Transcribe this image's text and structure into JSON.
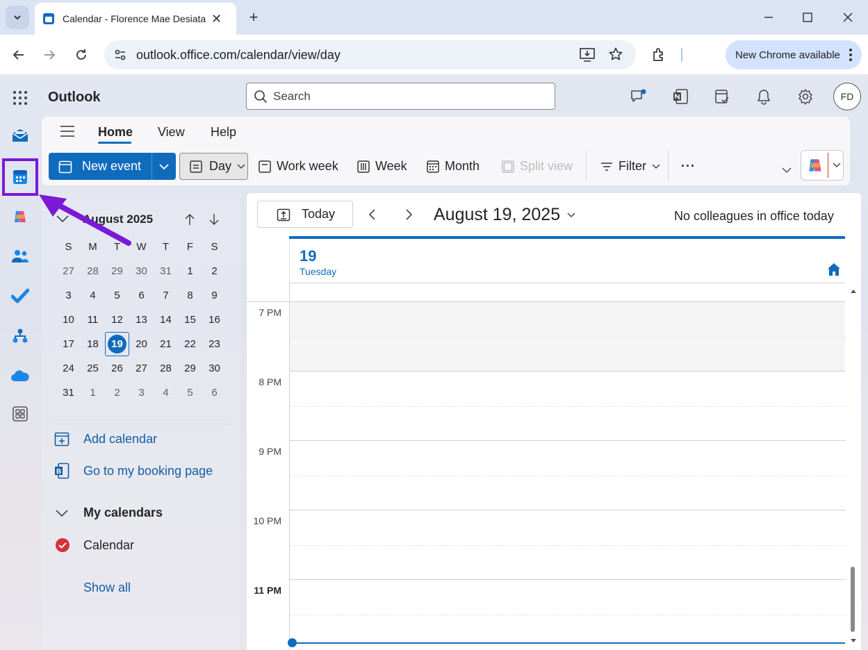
{
  "browser": {
    "tab_title": "Calendar - Florence Mae Desiata",
    "url": "outlook.office.com/calendar/view/day",
    "update_pill": "New Chrome available"
  },
  "app": {
    "name": "Outlook",
    "search_placeholder": "Search",
    "avatar_initials": "FD"
  },
  "ribbon": {
    "tabs": [
      "Home",
      "View",
      "Help"
    ],
    "new_event": "New event",
    "views": {
      "day": "Day",
      "work_week": "Work week",
      "week": "Week",
      "month": "Month",
      "split_view": "Split view"
    },
    "filter": "Filter",
    "more": "···"
  },
  "mini_calendar": {
    "month_label": "August 2025",
    "weekdays": [
      "S",
      "M",
      "T",
      "W",
      "T",
      "F",
      "S"
    ],
    "weeks": [
      [
        "27",
        "28",
        "29",
        "30",
        "31",
        "1",
        "2"
      ],
      [
        "3",
        "4",
        "5",
        "6",
        "7",
        "8",
        "9"
      ],
      [
        "10",
        "11",
        "12",
        "13",
        "14",
        "15",
        "16"
      ],
      [
        "17",
        "18",
        "19",
        "20",
        "21",
        "22",
        "23"
      ],
      [
        "24",
        "25",
        "26",
        "27",
        "28",
        "29",
        "30"
      ],
      [
        "31",
        "1",
        "2",
        "3",
        "4",
        "5",
        "6"
      ]
    ],
    "selected_day": "19"
  },
  "left_links": {
    "add_calendar": "Add calendar",
    "booking_page": "Go to my booking page",
    "my_calendars": "My calendars",
    "calendar": "Calendar",
    "show_all": "Show all"
  },
  "main": {
    "today_button": "Today",
    "date_title": "August 19, 2025",
    "colleagues": "No colleagues in office today",
    "day_number": "19",
    "day_name": "Tuesday",
    "time_labels": [
      "7 PM",
      "8 PM",
      "9 PM",
      "10 PM",
      "11 PM"
    ]
  },
  "colors": {
    "accent": "#0f6cbd",
    "annotation": "#7a19d6",
    "calendar_check": "#d13438"
  },
  "icons": {
    "rail": [
      "mail-icon",
      "calendar-icon",
      "copilot-icon",
      "people-icon",
      "todo-icon",
      "org-explorer-icon",
      "onedrive-icon",
      "more-apps-icon"
    ]
  }
}
